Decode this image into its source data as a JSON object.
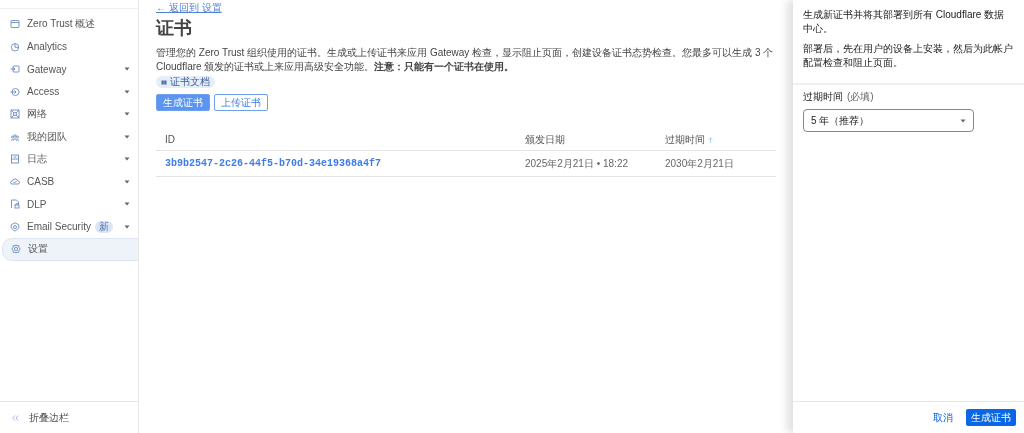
{
  "sidebar": {
    "items": [
      {
        "label": "Zero Trust 概述",
        "expandable": false,
        "selected": false
      },
      {
        "label": "Analytics",
        "expandable": false,
        "selected": false
      },
      {
        "label": "Gateway",
        "expandable": true,
        "selected": false
      },
      {
        "label": "Access",
        "expandable": true,
        "selected": false
      },
      {
        "label": "网络",
        "expandable": true,
        "selected": false
      },
      {
        "label": "我的团队",
        "expandable": true,
        "selected": false
      },
      {
        "label": "日志",
        "expandable": true,
        "selected": false
      },
      {
        "label": "CASB",
        "expandable": true,
        "selected": false
      },
      {
        "label": "DLP",
        "expandable": true,
        "selected": false
      },
      {
        "label": "Email Security",
        "expandable": true,
        "selected": false,
        "badge": "新"
      },
      {
        "label": "设置",
        "expandable": false,
        "selected": true
      }
    ],
    "collapse": "折叠边栏"
  },
  "main": {
    "back_link": "← 返回到 设置",
    "title": "证书",
    "description": "管理您的 Zero Trust 组织使用的证书。生成或上传证书来应用 Gateway 检查，显示阻止页面，创建设备证书态势检查。您最多可以生成 3 个 Cloudflare 颁发的证书或上来应用高级安全功能。**注意：只能有一个证书在使用。**",
    "docs_link": "证书文档",
    "buttons": [
      {
        "label": "生成证书",
        "kind": "primary"
      },
      {
        "label": "上传证书",
        "kind": "secondary"
      }
    ],
    "table": {
      "columns": [
        {
          "label": "ID",
          "sorted": false
        },
        {
          "label": "颁发日期",
          "sorted": false
        },
        {
          "label": "过期时间",
          "sorted": true
        }
      ],
      "rows": [
        [
          "3b9b2547-2c26-44f5-b70d-34e19368a4f7",
          "2025年2月21日 • 18:22",
          "2030年2月21日"
        ]
      ]
    }
  },
  "drawer": {
    "intro": "生成新证书并将其部署到所有 Cloudflare 数据中心。",
    "note": "部署后，先在用户的设备上安装，然后为此帐户配置检查和阻止页面。",
    "field": {
      "label": "过期时间",
      "hint": "(必填)",
      "value": "5 年（推荐）"
    },
    "buttons": [
      {
        "label": "取消",
        "kind": "link"
      },
      {
        "label": "生成证书",
        "kind": "primary"
      }
    ]
  }
}
